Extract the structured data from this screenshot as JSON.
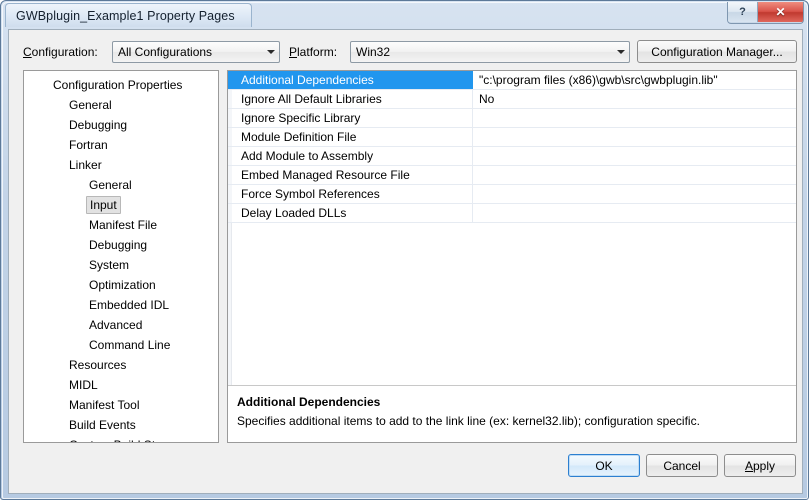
{
  "window": {
    "title": "GWBplugin_Example1 Property Pages",
    "help_button": "?",
    "close_button": "✕",
    "accent_selection": "#2196ee",
    "close_button_color": "#c0392f"
  },
  "toolbar": {
    "configuration_label_prefix": "C",
    "configuration_label_rest": "onfiguration:",
    "configuration_value": "All Configurations",
    "platform_label_prefix": "P",
    "platform_label_rest": "latform:",
    "platform_value": "Win32",
    "configuration_manager_label": "Configuration Manager..."
  },
  "tree": {
    "items": [
      {
        "label": "Configuration Properties",
        "depth": 0,
        "selected": false
      },
      {
        "label": "General",
        "depth": 1,
        "selected": false
      },
      {
        "label": "Debugging",
        "depth": 1,
        "selected": false
      },
      {
        "label": "Fortran",
        "depth": 1,
        "selected": false
      },
      {
        "label": "Linker",
        "depth": 1,
        "selected": false
      },
      {
        "label": "General",
        "depth": 2,
        "selected": false
      },
      {
        "label": "Input",
        "depth": 2,
        "selected": true
      },
      {
        "label": "Manifest File",
        "depth": 2,
        "selected": false
      },
      {
        "label": "Debugging",
        "depth": 2,
        "selected": false
      },
      {
        "label": "System",
        "depth": 2,
        "selected": false
      },
      {
        "label": "Optimization",
        "depth": 2,
        "selected": false
      },
      {
        "label": "Embedded IDL",
        "depth": 2,
        "selected": false
      },
      {
        "label": "Advanced",
        "depth": 2,
        "selected": false
      },
      {
        "label": "Command Line",
        "depth": 2,
        "selected": false
      },
      {
        "label": "Resources",
        "depth": 1,
        "selected": false
      },
      {
        "label": "MIDL",
        "depth": 1,
        "selected": false
      },
      {
        "label": "Manifest Tool",
        "depth": 1,
        "selected": false
      },
      {
        "label": "Build Events",
        "depth": 1,
        "selected": false
      },
      {
        "label": "Custom Build Step",
        "depth": 1,
        "selected": false
      }
    ]
  },
  "grid": {
    "rows": [
      {
        "name": "Additional Dependencies",
        "value": "\"c:\\program files (x86)\\gwb\\src\\gwbplugin.lib\"",
        "selected": true
      },
      {
        "name": "Ignore All Default Libraries",
        "value": "No",
        "selected": false
      },
      {
        "name": "Ignore Specific Library",
        "value": "",
        "selected": false
      },
      {
        "name": "Module Definition File",
        "value": "",
        "selected": false
      },
      {
        "name": "Add Module to Assembly",
        "value": "",
        "selected": false
      },
      {
        "name": "Embed Managed Resource File",
        "value": "",
        "selected": false
      },
      {
        "name": "Force Symbol References",
        "value": "",
        "selected": false
      },
      {
        "name": "Delay Loaded DLLs",
        "value": "",
        "selected": false
      }
    ]
  },
  "description": {
    "title": "Additional Dependencies",
    "body": "Specifies additional items to add to the link line (ex: kernel32.lib); configuration specific."
  },
  "footer": {
    "ok_label": "OK",
    "cancel_label": "Cancel",
    "apply_label_prefix": "A",
    "apply_label_rest": "pply"
  }
}
